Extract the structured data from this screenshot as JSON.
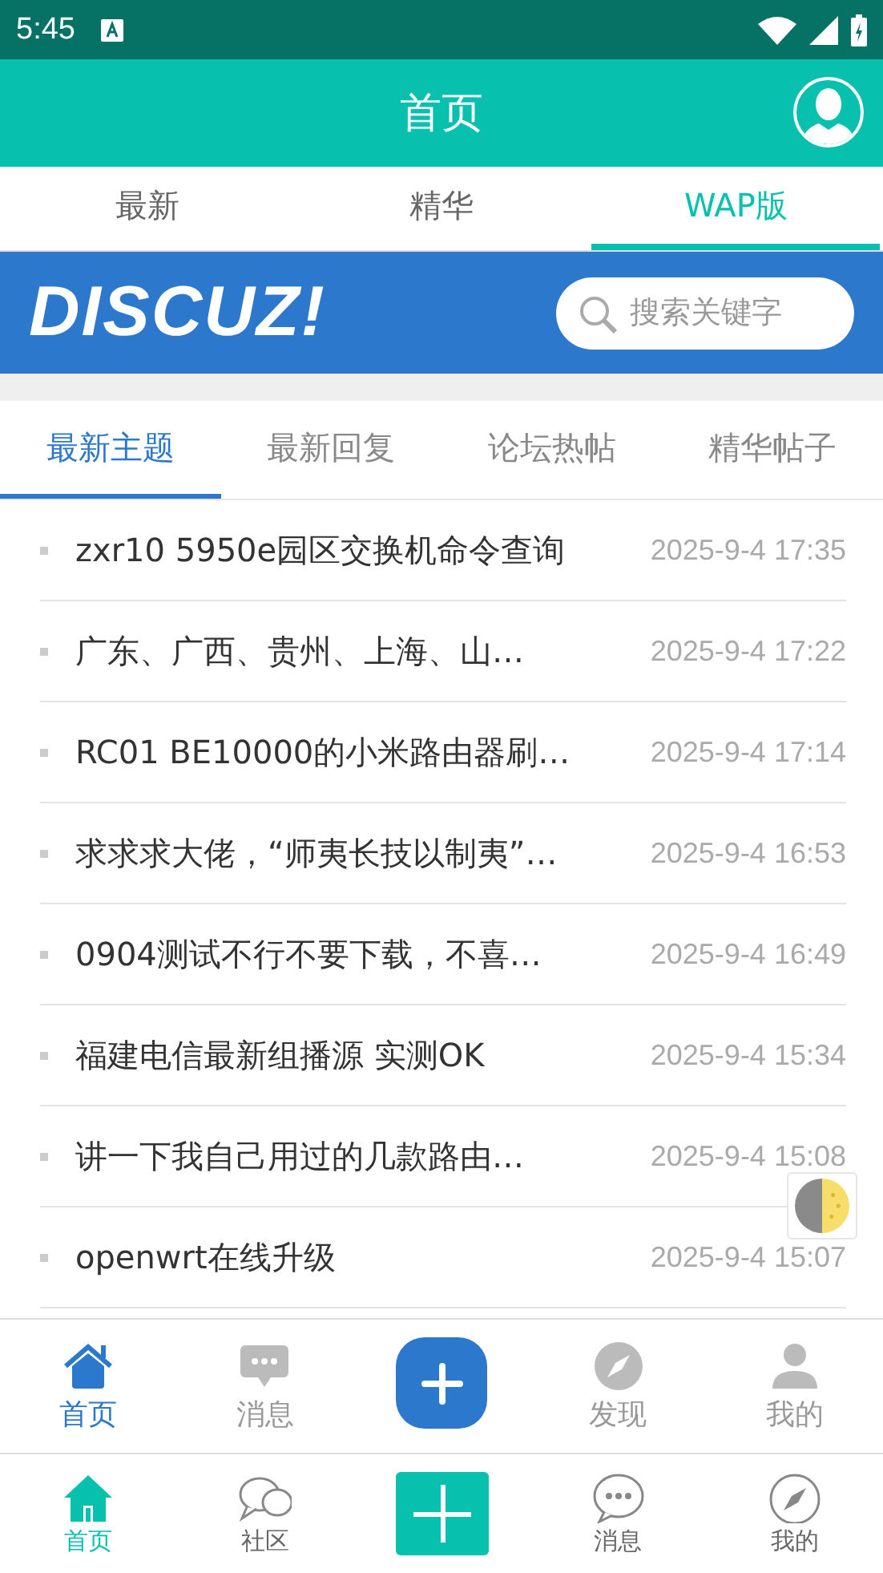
{
  "status_bar": {
    "time": "5:45"
  },
  "app_bar": {
    "title": "首页"
  },
  "tabs": [
    {
      "label": "最新",
      "selected": false
    },
    {
      "label": "精华",
      "selected": false
    },
    {
      "label": "WAP版",
      "selected": true
    }
  ],
  "banner": {
    "logo": "DISCUZ!",
    "search": {
      "placeholder": "搜索关键字"
    }
  },
  "sub_tabs": [
    {
      "label": "最新主题",
      "selected": true
    },
    {
      "label": "最新回复",
      "selected": false
    },
    {
      "label": "论坛热帖",
      "selected": false
    },
    {
      "label": "精华帖子",
      "selected": false
    }
  ],
  "threads": [
    {
      "title": "zxr10 5950e园区交换机命令查询",
      "time": "2025-9-4 17:35"
    },
    {
      "title": "广东、广西、贵州、上海、山…",
      "time": "2025-9-4 17:22"
    },
    {
      "title": "RC01 BE10000的小米路由器刷…",
      "time": "2025-9-4 17:14"
    },
    {
      "title": "求求求大佬，“师夷长技以制夷”…",
      "time": "2025-9-4 16:53"
    },
    {
      "title": "0904测试不行不要下载，不喜…",
      "time": "2025-9-4 16:49"
    },
    {
      "title": "福建电信最新组播源 实测OK",
      "time": "2025-9-4 15:34"
    },
    {
      "title": "讲一下我自己用过的几款路由…",
      "time": "2025-9-4 15:08"
    },
    {
      "title": "openwrt在线升级",
      "time": "2025-9-4 15:07"
    }
  ],
  "web_nav": [
    {
      "kind": "tab",
      "label": "首页",
      "selected": true
    },
    {
      "kind": "tab",
      "label": "消息",
      "selected": false
    },
    {
      "kind": "plus"
    },
    {
      "kind": "tab",
      "label": "发现",
      "selected": false
    },
    {
      "kind": "tab",
      "label": "我的",
      "selected": false
    }
  ],
  "app_nav": [
    {
      "kind": "tab",
      "label": "首页",
      "selected": true
    },
    {
      "kind": "tab",
      "label": "社区",
      "selected": false
    },
    {
      "kind": "plus"
    },
    {
      "kind": "tab",
      "label": "消息",
      "selected": false
    },
    {
      "kind": "tab",
      "label": "我的",
      "selected": false
    }
  ]
}
